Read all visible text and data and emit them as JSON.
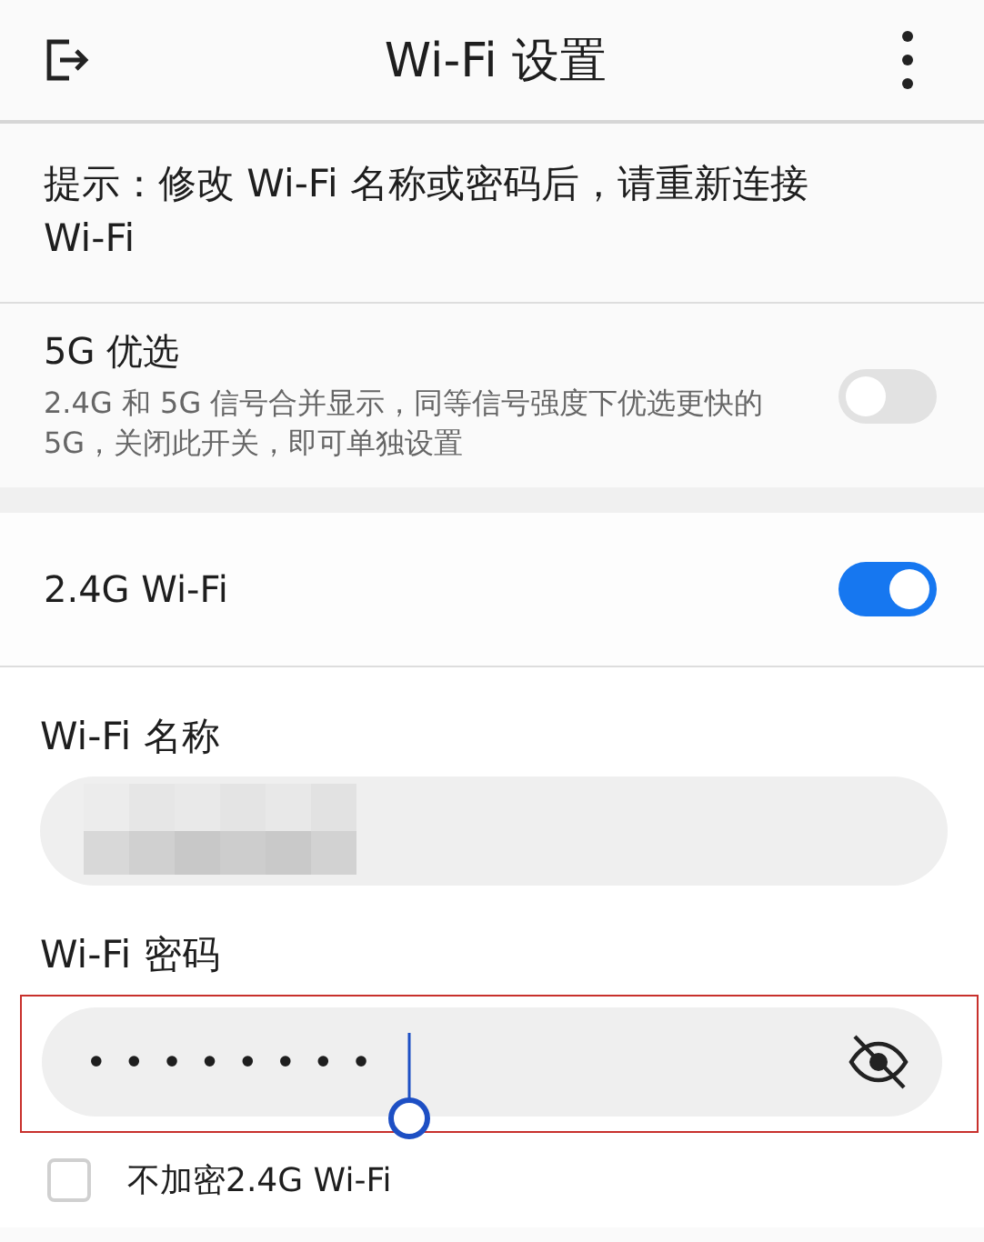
{
  "header": {
    "title": "Wi-Fi 设置"
  },
  "notice": "提示：修改 Wi-Fi 名称或密码后，请重新连接 Wi-Fi",
  "band_steering": {
    "title": "5G 优选",
    "description": "2.4G 和 5G 信号合并显示，同等信号强度下优选更快的 5G，关闭此开关，即可单独设置",
    "on": false
  },
  "wifi_24": {
    "title": "2.4G Wi-Fi",
    "on": true
  },
  "fields": [
    {
      "kind": "redacted",
      "label": "Wi-Fi 名称",
      "highlighted": false
    },
    {
      "kind": "password",
      "label": "Wi-Fi 密码",
      "value": "••••••••",
      "highlighted": true
    }
  ],
  "checkboxes": [
    {
      "label": "不加密2.4G Wi-Fi",
      "checked": false
    }
  ]
}
